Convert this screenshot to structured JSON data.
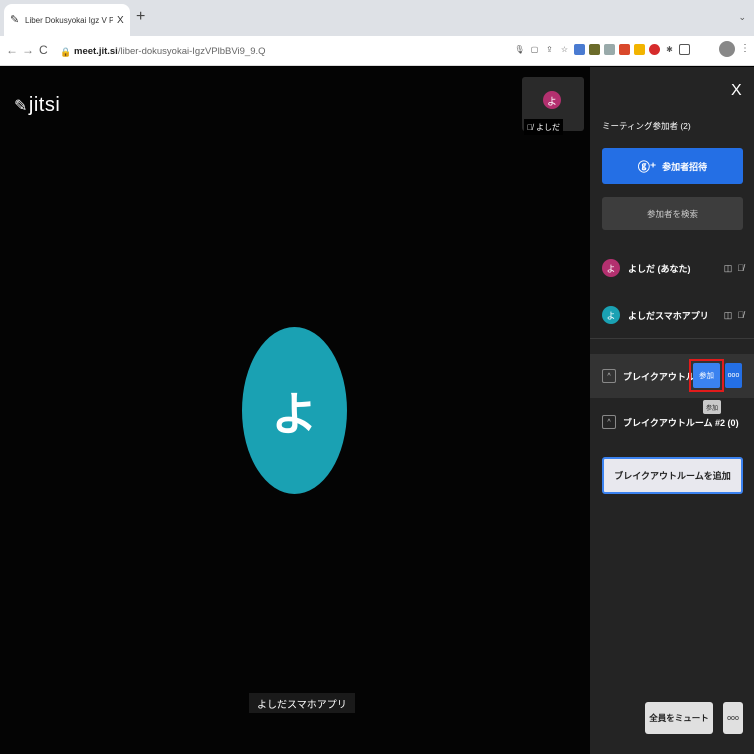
{
  "browser": {
    "tab_title": "Liber Dokusyokai Igz V Plb B V",
    "tab_close": "X",
    "new_tab": "+",
    "tab_menu": "⌄",
    "url_domain": "meet.jit.si",
    "url_path": "/liber-dokusyokai-IgzVPlbBVi9_9.Q",
    "back": "←",
    "forward": "→",
    "reload": "C",
    "menu": "⋮"
  },
  "stage": {
    "logo_text": "jitsi",
    "thumbnail": {
      "avatar_char": "よ",
      "name": "よしだ"
    },
    "speaker": {
      "avatar_char": "よ",
      "name": "よしだスマホアプリ"
    }
  },
  "panel": {
    "close": "X",
    "heading": "ミーティング参加者 (2)",
    "invite_label": "参加者招待",
    "search_placeholder": "参加者を検索",
    "participants": [
      {
        "avatar_char": "よ",
        "name": "よしだ (あなた)",
        "color": "#b3306f"
      },
      {
        "avatar_char": "よ",
        "name": "よしだスマホアプリ",
        "color": "#1aa1b3"
      }
    ],
    "breakout_rooms": [
      {
        "name": "ブレイクアウトル..",
        "join_label": "参加",
        "more_label": "ooo"
      },
      {
        "name": "ブレイクアウトルーム #2 (0)"
      }
    ],
    "tooltip": "参加",
    "add_breakout_label": "ブレイクアウトルームを追加",
    "mute_all_label": "全員をミュート",
    "more_label": "ooo"
  },
  "colors": {
    "accent": "#246fe5",
    "highlight": "#e21b1b",
    "speaker_avatar": "#1aa1b3"
  }
}
